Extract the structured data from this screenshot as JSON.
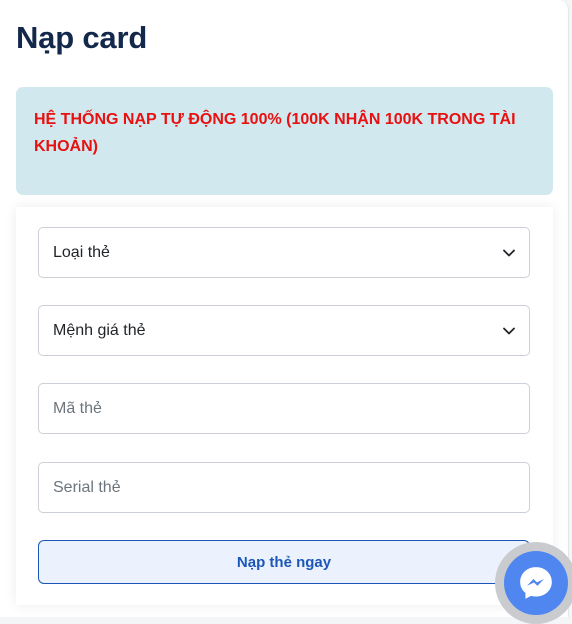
{
  "page": {
    "title": "Nạp card"
  },
  "notice": {
    "text": "HỆ THỐNG NẠP TỰ ĐỘNG 100% (100K NHẬN 100K TRONG TÀI KHOẢN)",
    "text_color": "#e81010",
    "bg_color": "#d1e8ef"
  },
  "form": {
    "card_type": {
      "selected": "Loại thẻ",
      "icon": "chevron-down-icon"
    },
    "denomination": {
      "selected": "Mệnh giá thẻ",
      "icon": "chevron-down-icon"
    },
    "card_code": {
      "placeholder": "Mã thẻ",
      "value": ""
    },
    "serial": {
      "placeholder": "Serial thẻ",
      "value": ""
    },
    "submit_label": "Nạp thẻ ngay"
  },
  "chat_widget": {
    "icon": "messenger-icon",
    "color": "#4f86ef"
  },
  "colors": {
    "title": "#14284b",
    "accent": "#1b57b8"
  }
}
